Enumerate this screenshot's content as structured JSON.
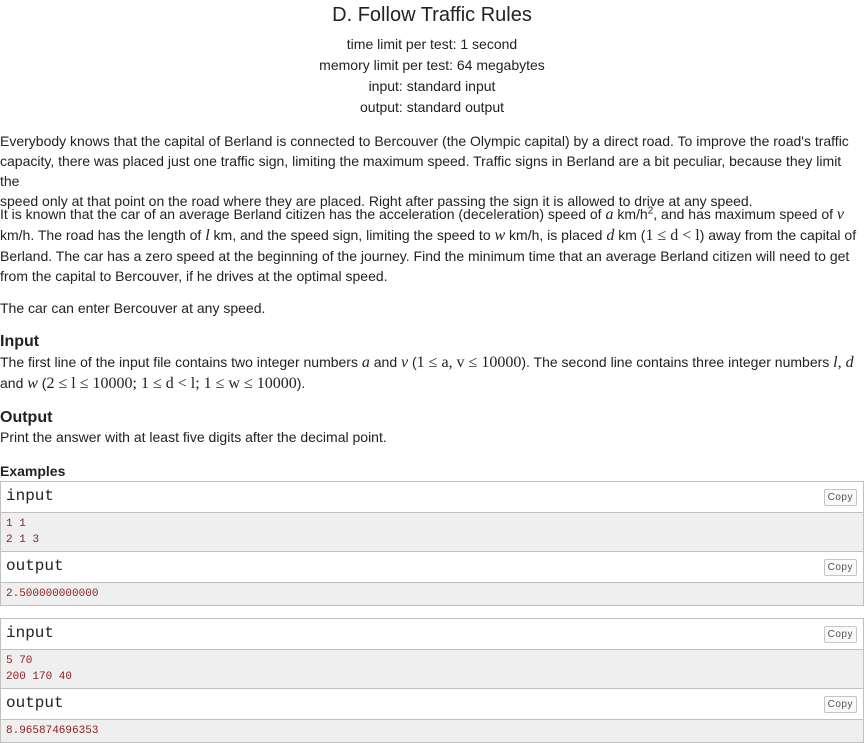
{
  "problem": {
    "title": "D. Follow Traffic Rules",
    "time_limit": "time limit per test: 1 second",
    "memory_limit": "memory limit per test: 64 megabytes",
    "input_file": "input: standard input",
    "output_file": "output: standard output"
  },
  "statement": {
    "p1_line1": "Everybody knows that the capital of Berland is connected to Bercouver (the Olympic capital) by a direct road. To improve the road's traffic",
    "p1_line2": "capacity, there was placed just one traffic sign, limiting the maximum speed. Traffic signs in Berland are a bit peculiar, because they limit the",
    "p1_line3": "speed only at that point on the road where they are placed. Right after passing the sign it is allowed to drive at any speed.",
    "p2_l1_a": "It is known that the car of an average Berland citizen has the acceleration (deceleration) speed of ",
    "p2_l1_var_a": "a",
    "p2_l1_b": " km/h",
    "p2_l1_sup": "2",
    "p2_l1_c": ", and has maximum speed of ",
    "p2_l1_var_v": "v",
    "p2_l2_a": "km/h. The road has the length of ",
    "p2_l2_var_l": "l",
    "p2_l2_b": " km, and the speed sign, limiting the speed to ",
    "p2_l2_var_w": "w",
    "p2_l2_c": " km/h, is placed ",
    "p2_l2_var_d": "d",
    "p2_l2_d": " km (",
    "p2_l2_math": "1 ≤ d < l",
    "p2_l2_e": ") away from the capital of",
    "p2_l3": "Berland. The car has a zero speed at the beginning of the journey. Find the minimum time that an average Berland citizen will need to get",
    "p2_l4": "from the capital to Bercouver, if he drives at the optimal speed.",
    "p3": "The car can enter Bercouver at any speed."
  },
  "input_section": {
    "title": "Input",
    "l1_a": "The first line of the input file contains two integer numbers ",
    "l1_var_a": "a",
    "l1_and": " and ",
    "l1_var_v": "v",
    "l1_paren": " (",
    "l1_math": "1 ≤ a, v ≤ 10000",
    "l1_b": "). The second line contains three integer numbers ",
    "l1_var_ld": "l, d",
    "l2_a": "and ",
    "l2_var_w": "w",
    "l2_paren": " (",
    "l2_math": "2 ≤ l ≤ 10000; 1 ≤ d < l; 1 ≤ w ≤ 10000",
    "l2_b": ")."
  },
  "output_section": {
    "title": "Output",
    "text": "Print the answer with at least five digits after the decimal point."
  },
  "examples": {
    "title": "Examples",
    "copy_label": "Copy",
    "input_label": "input",
    "output_label": "output",
    "items": [
      {
        "input": "1 1\n2 1 3",
        "output": "2.500000000000"
      },
      {
        "input": "5 70\n200 170 40",
        "output": "8.965874696353"
      }
    ]
  }
}
